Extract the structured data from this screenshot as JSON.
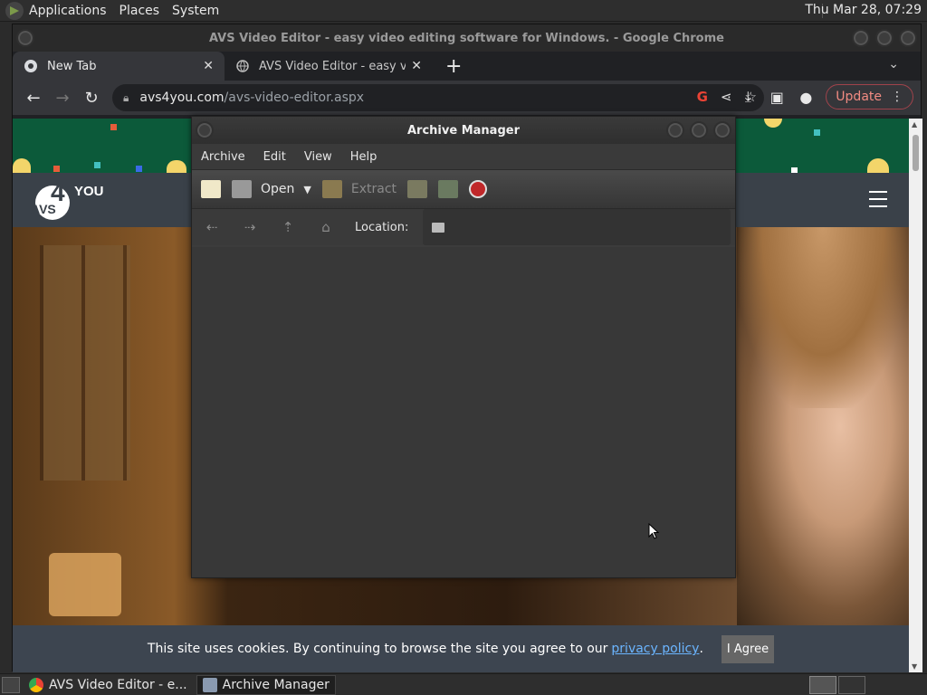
{
  "top_panel": {
    "menus": [
      "Applications",
      "Places",
      "System"
    ],
    "clock": "Thu Mar 28, 07:29"
  },
  "chrome": {
    "window_title": "AVS Video Editor - easy video editing software for Windows. - Google Chrome",
    "tabs": [
      {
        "title": "New Tab",
        "active": true
      },
      {
        "title": "AVS Video Editor - easy video",
        "active": false
      }
    ],
    "url_host": "avs4you.com",
    "url_path": "/avs-video-editor.aspx",
    "update_label": "Update"
  },
  "site": {
    "logo_four": "4",
    "logo_you": "YOU",
    "logo_avs": "AVS",
    "cookie_text": "This site uses cookies. By continuing to browse the site you agree to our",
    "cookie_link": "privacy policy",
    "cookie_period": ".",
    "agree_label": "I Agree"
  },
  "archive_manager": {
    "title": "Archive Manager",
    "menus": [
      "Archive",
      "Edit",
      "View",
      "Help"
    ],
    "toolbar": {
      "open_label": "Open",
      "extract_label": "Extract"
    },
    "location_label": "Location:"
  },
  "taskbar": {
    "tasks": [
      {
        "label": "AVS Video Editor - e..."
      },
      {
        "label": "Archive Manager"
      }
    ]
  },
  "colors": {
    "chrome_bg": "#202124",
    "toolbar_bg": "#35363a",
    "update_accent": "#f28b82",
    "link": "#6bb5ff",
    "site_header": "#3a4149"
  }
}
